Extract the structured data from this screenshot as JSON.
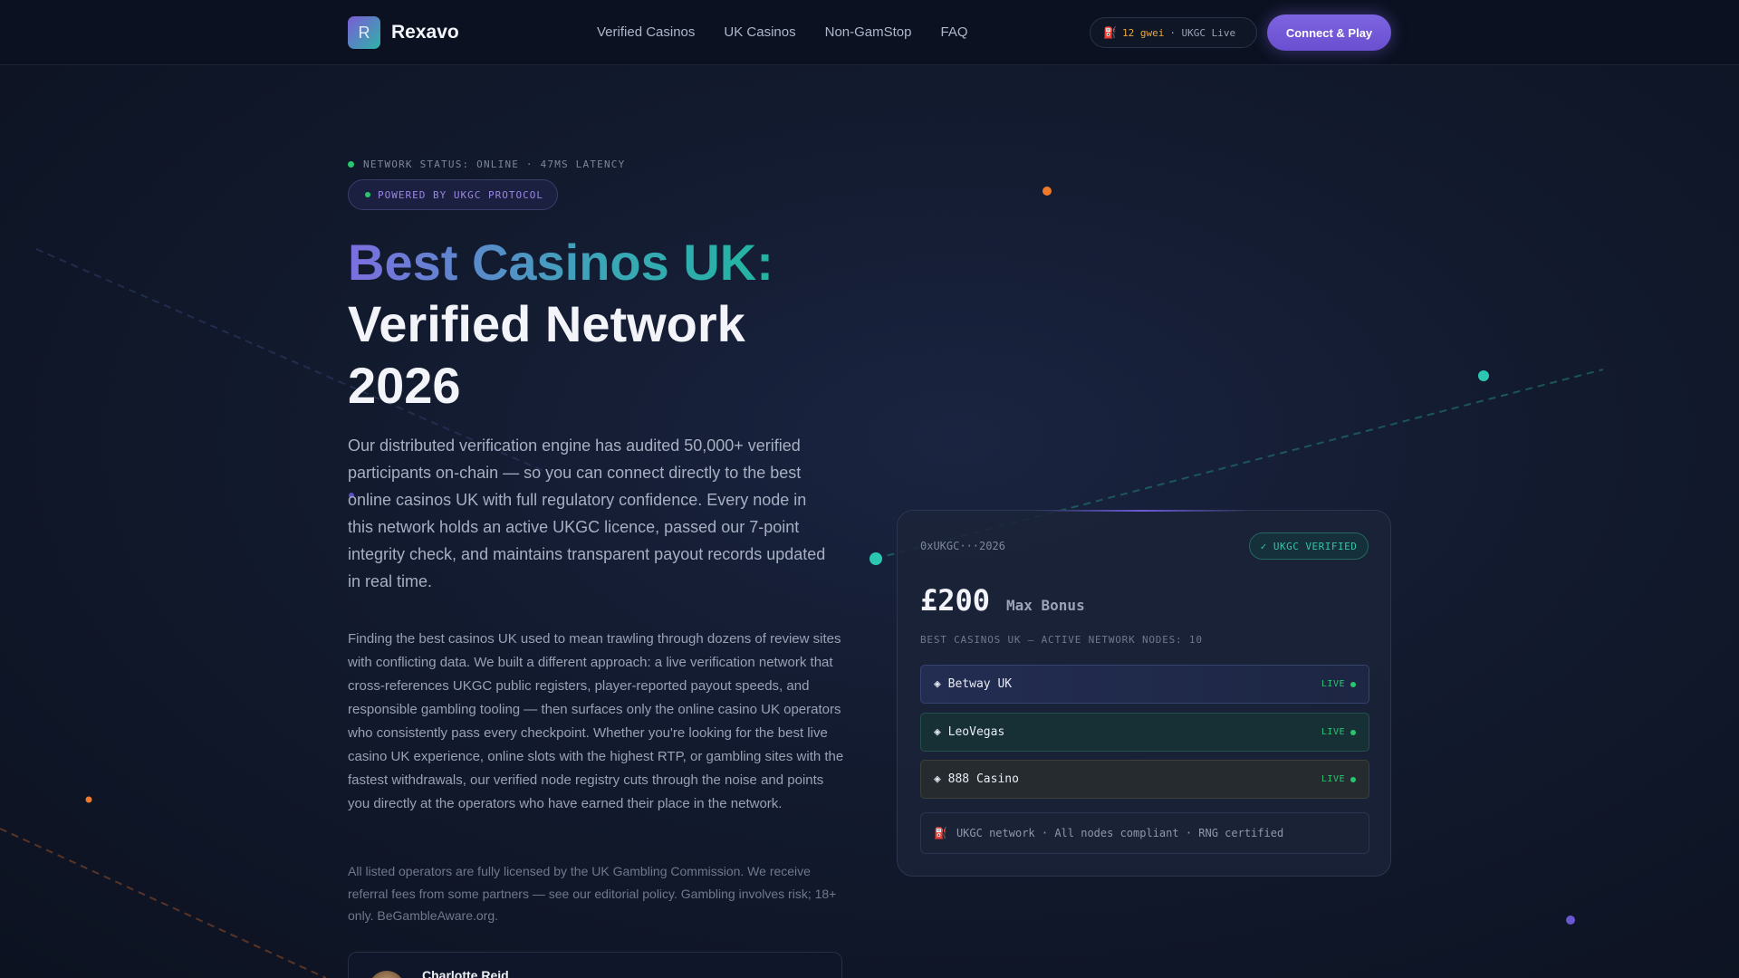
{
  "brand": {
    "logo_letter": "R",
    "name": "Rexavo"
  },
  "nav": [
    "Verified Casinos",
    "UK Casinos",
    "Non-GamStop",
    "FAQ"
  ],
  "header": {
    "gas_icon": "fuel-pump-icon",
    "gas_value": "12 gwei",
    "gas_suffix": "· UKGC Live",
    "connect_label": "Connect & Play"
  },
  "hero": {
    "status": "NETWORK STATUS: ONLINE · 47MS LATENCY",
    "powered": "POWERED BY UKGC PROTOCOL",
    "title_gradient": "Best Casinos UK:",
    "title_plain": "Verified Network 2026",
    "lead": "Our distributed verification engine has audited 50,000+ verified participants on-chain — so you can connect directly to the best online casinos UK with full regulatory confidence. Every node in this network holds an active UKGC licence, passed our 7-point integrity check, and maintains transparent payout records updated in real time.",
    "body": "Finding the best casinos UK used to mean trawling through dozens of review sites with conflicting data. We built a different approach: a live verification network that cross-references UKGC public registers, player-reported payout speeds, and responsible gambling tooling — then surfaces only the online casino UK operators who consistently pass every checkpoint. Whether you're looking for the best live casino UK experience, online slots with the highest RTP, or gambling sites with the fastest withdrawals, our verified node registry cuts through the noise and points you directly at the operators who have earned their place in the network.",
    "disclaimer": "All listed operators are fully licensed by the UK Gambling Commission. We receive referral fees from some partners — see our editorial policy. Gambling involves risk; 18+ only. BeGambleAware.org.",
    "author": "Charlotte Reid"
  },
  "card": {
    "hash": "0xUKGC···2026",
    "verified": "✓ UKGC VERIFIED",
    "bonus_amount": "£200",
    "bonus_label": "Max Bonus",
    "nodes_label": "BEST CASINOS UK — ACTIVE NETWORK NODES: 10",
    "rows": [
      {
        "name": "◈ Betway UK",
        "status": "LIVE"
      },
      {
        "name": "◈ LeoVegas",
        "status": "LIVE"
      },
      {
        "name": "◈ 888 Casino",
        "status": "LIVE"
      }
    ],
    "footer_icon": "⛽",
    "footer": "UKGC network · All nodes compliant · RNG certified"
  },
  "colors": {
    "accent_purple": "#7d64e0",
    "accent_teal": "#22b5a0",
    "live_green": "#28c76f",
    "gas_amber": "#e8a83a"
  }
}
